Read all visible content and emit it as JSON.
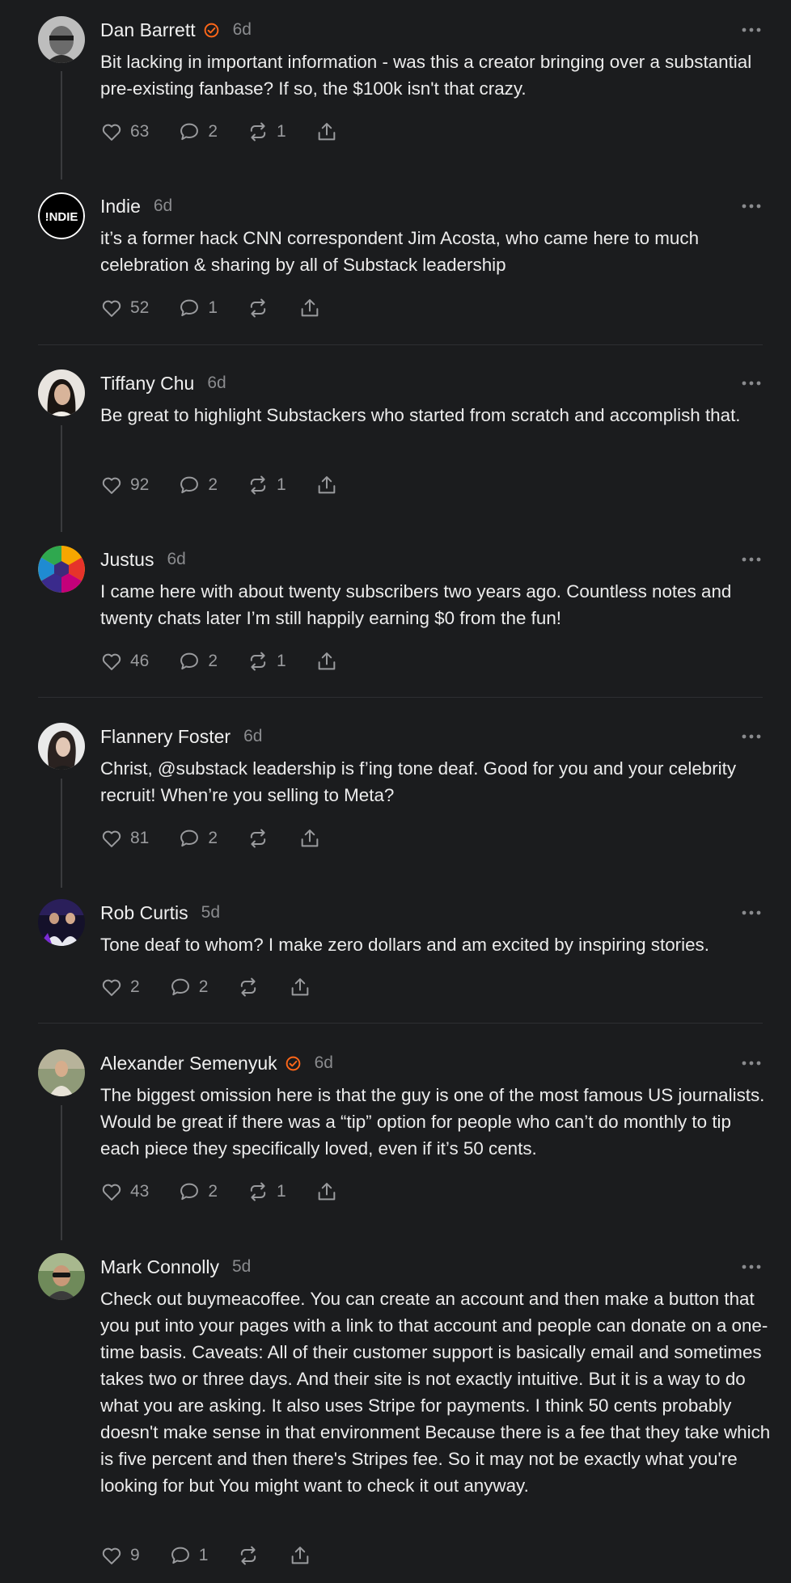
{
  "comments": [
    {
      "name": "Dan Barrett",
      "verified": true,
      "time": "6d",
      "text": "Bit lacking in important information - was this a creator bringing over a substantial pre-existing fanbase? If so, the $100k isn't that crazy.",
      "likes": "63",
      "replies": "2",
      "restacks": "1"
    },
    {
      "name": "Indie",
      "verified": false,
      "time": "6d",
      "avatar_text": "!NDIE",
      "text": "it’s a former hack CNN correspondent Jim Acosta, who came here to much celebration & sharing by all of Substack leadership",
      "likes": "52",
      "replies": "1",
      "restacks": ""
    },
    {
      "name": "Tiffany Chu",
      "verified": false,
      "time": "6d",
      "text": "Be great to highlight Substackers who started from scratch and accomplish that.",
      "likes": "92",
      "replies": "2",
      "restacks": "1"
    },
    {
      "name": "Justus",
      "verified": false,
      "time": "6d",
      "text": "I came here with about twenty subscribers two years ago. Countless notes and twenty chats later I’m still happily earning $0 from the fun!",
      "likes": "46",
      "replies": "2",
      "restacks": "1"
    },
    {
      "name": "Flannery Foster",
      "verified": false,
      "time": "6d",
      "text": "Christ, @substack leadership is f’ing tone deaf. Good for you and your celebrity recruit! When’re you selling to Meta?",
      "likes": "81",
      "replies": "2",
      "restacks": ""
    },
    {
      "name": "Rob Curtis",
      "verified": false,
      "time": "5d",
      "text": "Tone deaf to whom? I make zero dollars and am excited by inspiring stories.",
      "likes": "2",
      "replies": "2",
      "restacks": ""
    },
    {
      "name": "Alexander Semenyuk",
      "verified": true,
      "time": "6d",
      "text": "The biggest omission here is that the guy is one of the most famous US journalists. Would be great if there was a “tip” option for people who can’t do monthly to tip each piece they specifically loved, even if it’s 50 cents.",
      "likes": "43",
      "replies": "2",
      "restacks": "1"
    },
    {
      "name": "Mark Connolly",
      "verified": false,
      "time": "5d",
      "text": "Check out buymeacoffee. You can create an account and then make a button that you put into your pages with a link to that account and people can donate on a one-time basis. Caveats: All of their customer support is basically email and sometimes takes two or three days. And their site is not exactly intuitive. But it is a way to do what you are asking. It also uses Stripe for payments. I think 50 cents probably doesn't make sense in that environment Because there is a fee that they take which is five percent and then there's Stripes fee. So it may not be exactly what you're looking for but You might want to check it out anyway.",
      "likes": "9",
      "replies": "1",
      "restacks": ""
    }
  ],
  "colors": {
    "background": "#1b1c1e",
    "text": "#ececec",
    "muted": "#9a9b9e",
    "verified": "#ff6719",
    "divider": "#2e2f32"
  },
  "icons": [
    "verified-icon",
    "more-icon",
    "heart-icon",
    "comment-icon",
    "restack-icon",
    "share-icon"
  ]
}
